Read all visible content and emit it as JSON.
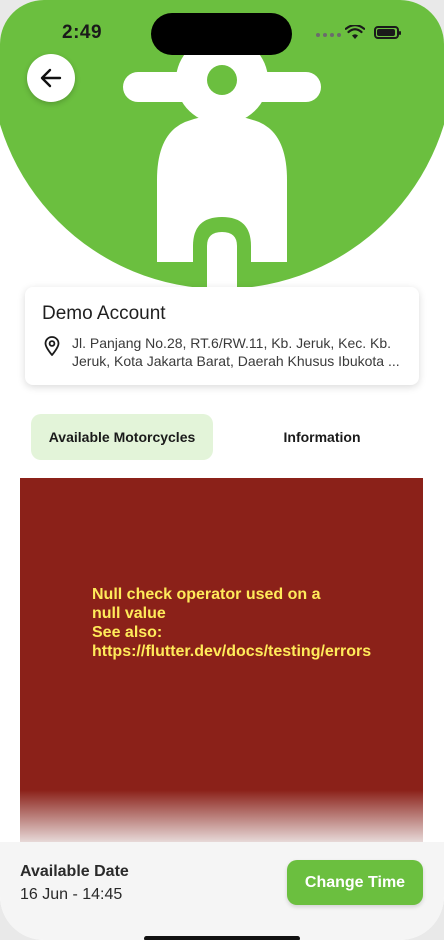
{
  "status_bar": {
    "time": "2:49",
    "icons": [
      "signal-dots-icon",
      "wifi-icon",
      "battery-icon"
    ]
  },
  "hero": {
    "background_color": "#6bbf3f",
    "icon": "scooter-icon"
  },
  "back_button": {
    "icon": "arrow-left-icon"
  },
  "account": {
    "name": "Demo Account",
    "address_icon": "location-pin-icon",
    "address": "Jl. Panjang No.28, RT.6/RW.11, Kb. Jeruk, Kec. Kb. Jeruk, Kota Jakarta Barat, Daerah Khusus Ibukota ..."
  },
  "tabs": [
    {
      "label": "Available Motorcycles",
      "active": true
    },
    {
      "label": "Information",
      "active": false
    }
  ],
  "error": {
    "line1": "Null check operator used on a null value",
    "line2": "See also: https://flutter.dev/docs/testing/errors",
    "background_color": "#8b2119",
    "text_color": "#ffeb5a"
  },
  "bottom_bar": {
    "date_label": "Available Date",
    "date_value": "16 Jun - 14:45",
    "button_label": "Change Time",
    "accent_color": "#6bbf3f"
  }
}
